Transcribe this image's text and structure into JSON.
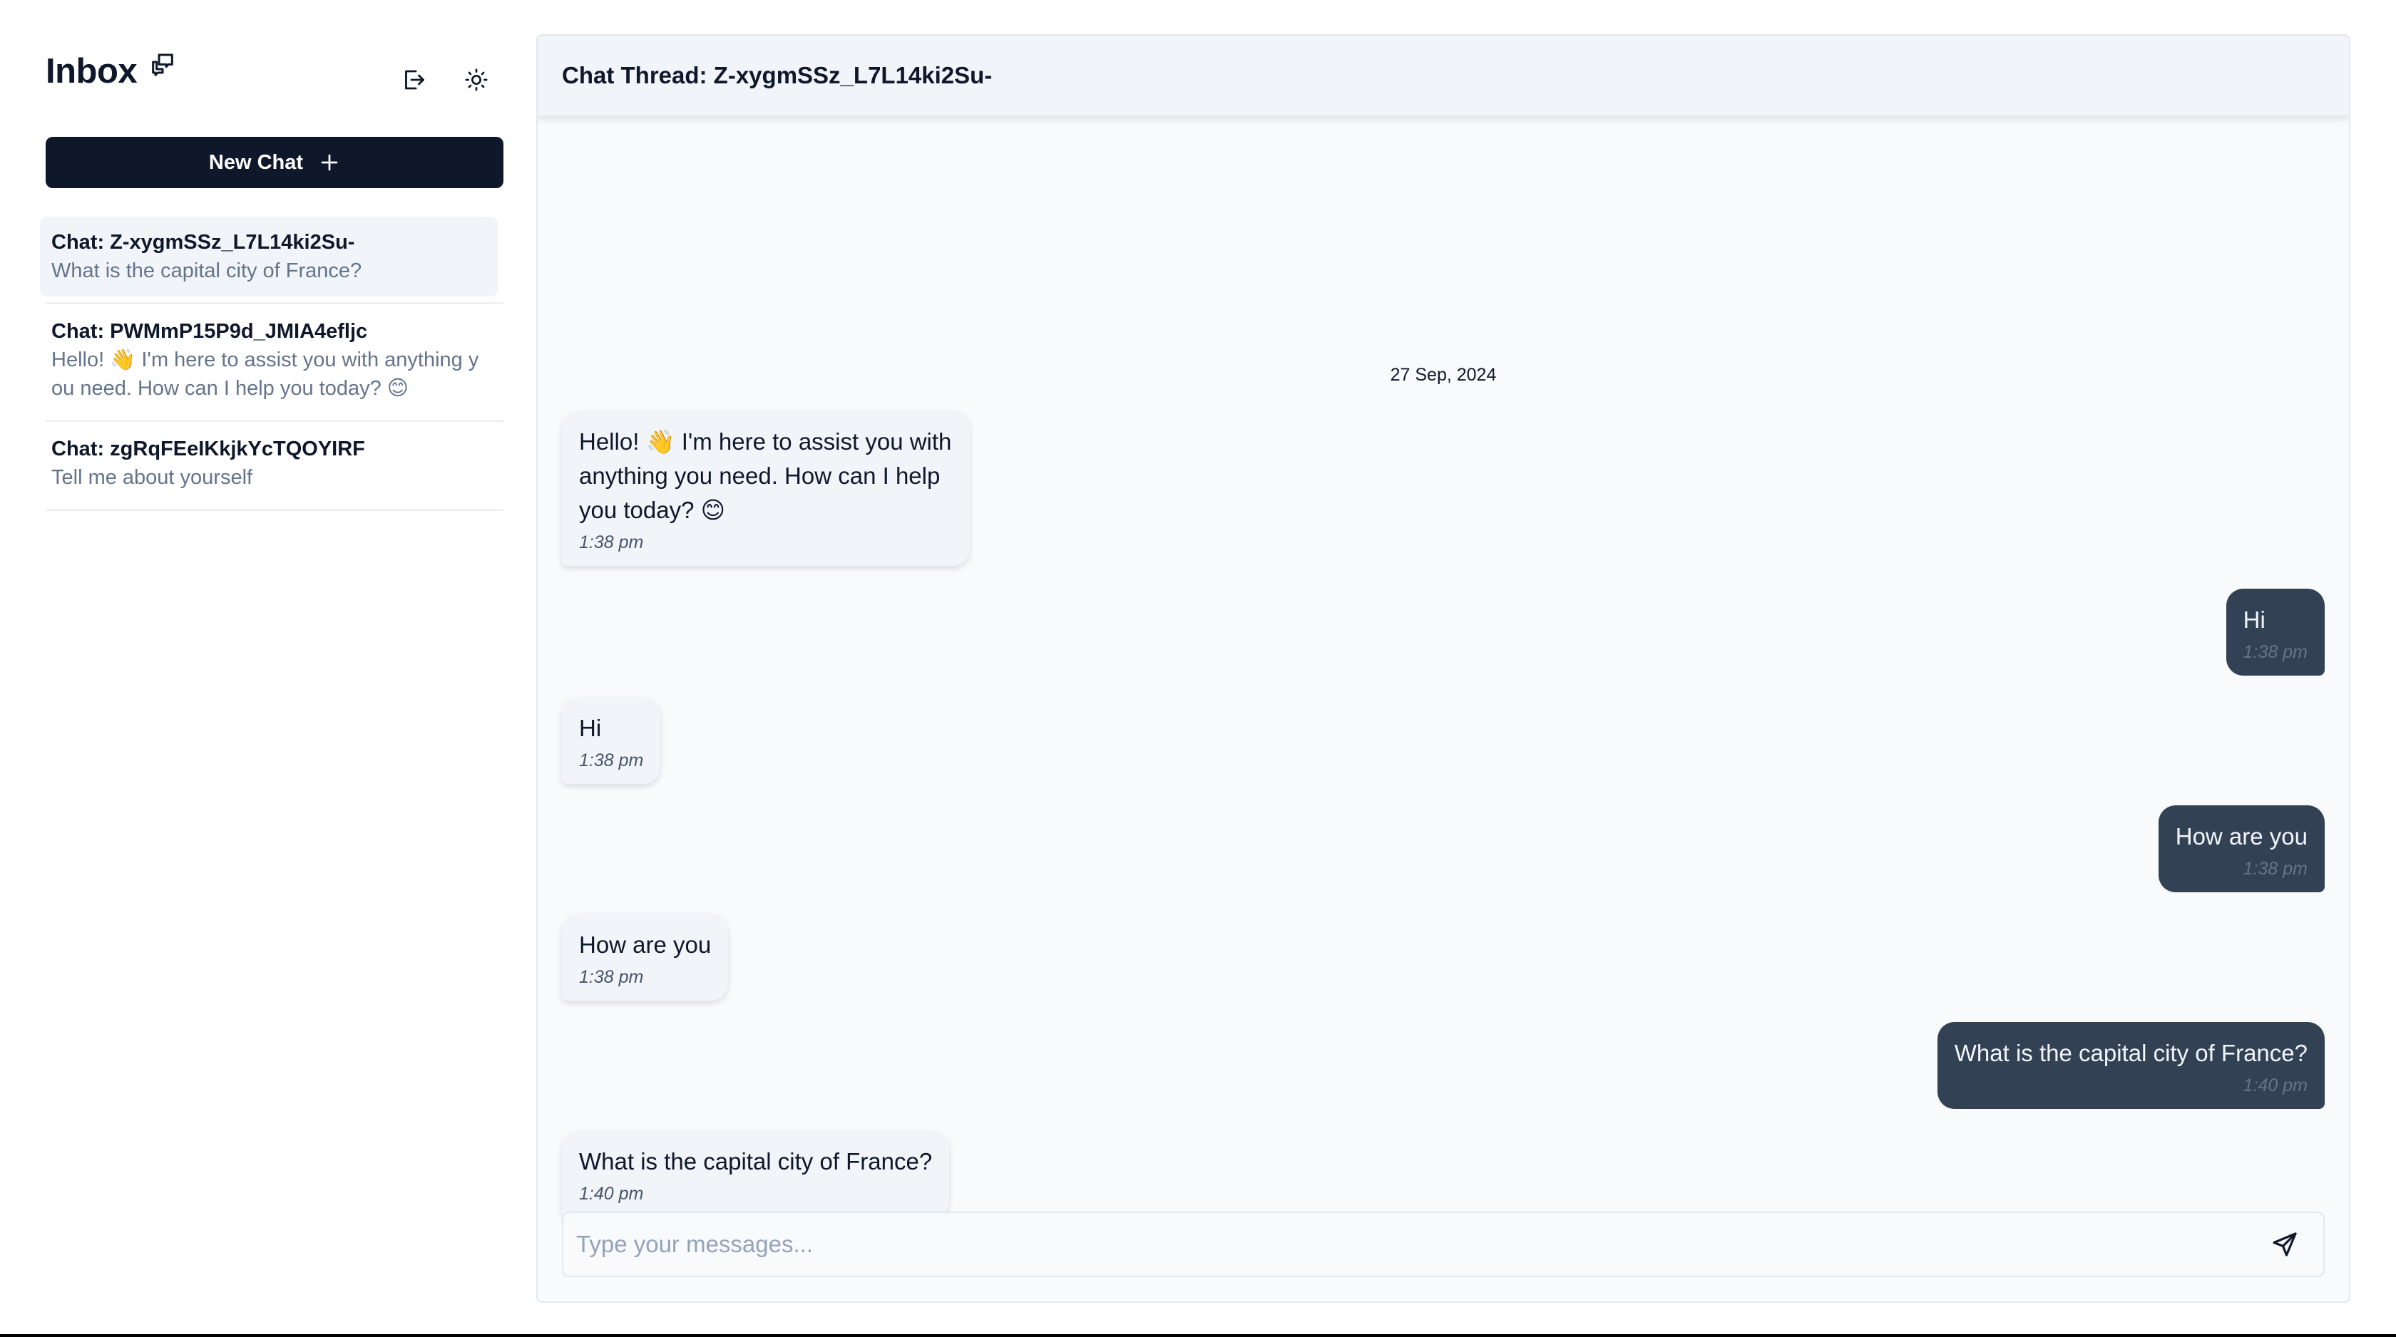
{
  "sidebar": {
    "title": "Inbox",
    "icons": {
      "title_icon": "chat-bubbles-icon",
      "logout": "logout-icon",
      "theme": "sun-icon"
    },
    "new_chat_label": "New Chat",
    "chats": [
      {
        "title": "Chat: Z-xygmSSz_L7L14ki2Su-",
        "preview": "What is the capital city of France?",
        "active": true
      },
      {
        "title": "Chat: PWMmP15P9d_JMIA4efljc",
        "preview_line1": "Hello! 👋 I'm here to assist you with anything y",
        "preview_line2": "ou need. How can I help you today? 😊",
        "active": false
      },
      {
        "title": "Chat: zgRqFEeIKkjkYcTQOYIRF",
        "preview": "Tell me about yourself",
        "active": false
      }
    ]
  },
  "thread": {
    "header": "Chat Thread: Z-xygmSSz_L7L14ki2Su-",
    "date": "27 Sep, 2024",
    "messages": [
      {
        "side": "in",
        "lines": [
          "Hello! 👋 I'm here to assist you with",
          "anything you need. How can I help",
          "you today? 😊"
        ],
        "time": "1:38 pm"
      },
      {
        "side": "out",
        "text": "Hi",
        "time": "1:38 pm"
      },
      {
        "side": "in",
        "text": "Hi",
        "time": "1:38 pm"
      },
      {
        "side": "out",
        "text": "How are you",
        "time": "1:38 pm"
      },
      {
        "side": "in",
        "text": "How are you",
        "time": "1:38 pm"
      },
      {
        "side": "out",
        "text": "What is the capital city of France?",
        "time": "1:40 pm"
      },
      {
        "side": "in",
        "text": "What is the capital city of France?",
        "time": "1:40 pm"
      }
    ],
    "composer": {
      "placeholder": "Type your messages...",
      "send_icon": "send-icon"
    }
  },
  "colors": {
    "primary": "#0f172a",
    "outgoing_bubble": "#334155",
    "incoming_bubble": "#f1f5f9",
    "panel_bg": "#f8fafc",
    "muted_text": "#64748b"
  }
}
